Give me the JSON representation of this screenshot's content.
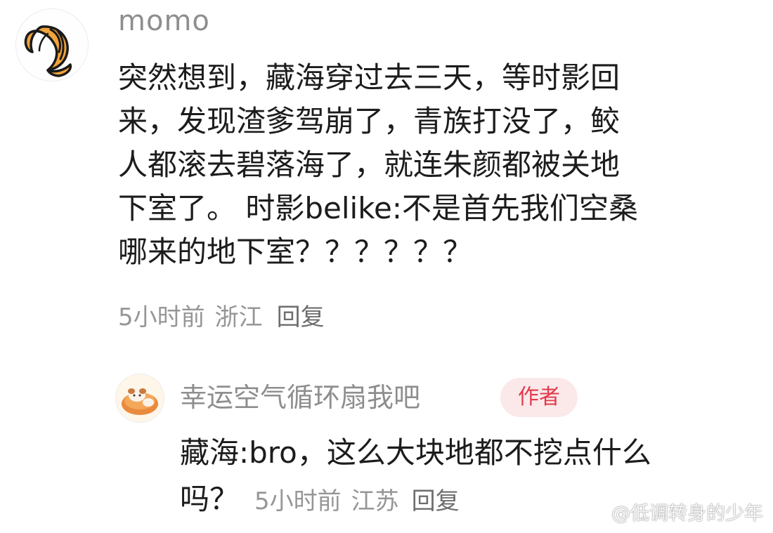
{
  "main_comment": {
    "username": "momo",
    "avatar_icon": "croissant-icon",
    "lines": [
      "突然想到，藏海穿过去三天，等时影回",
      "来，发现渣爹驾崩了，青族打没了，鲛",
      "人都滚去碧落海了，就连朱颜都被关地",
      "下室了。 时影belike:不是首先我们空桑",
      "哪来的地下室？？？？？？"
    ],
    "time": "5小时前",
    "location": "浙江",
    "reply_label": "回复"
  },
  "reply_comment": {
    "username": "幸运空气循环扇我吧",
    "avatar_icon": "bread-cat-icon",
    "badge": "作者",
    "line1": "藏海:bro，这么大块地都不挖点什么",
    "line2": "吗？",
    "time": "5小时前",
    "location": "江苏",
    "reply_label": "回复"
  },
  "watermark": {
    "text": "@低调转身的少年",
    "icon": "weibo-icon"
  },
  "colors": {
    "text_primary": "#1c1c1c",
    "text_secondary": "#969696",
    "badge_bg": "#fbe9ea",
    "badge_text": "#e2394b",
    "croissant": "#f2a33a"
  }
}
